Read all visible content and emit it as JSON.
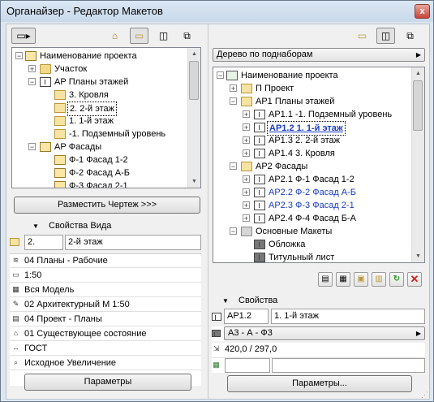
{
  "window": {
    "title": "Органайзер - Редактор Макетов",
    "close_label": "x"
  },
  "left": {
    "tree_root": "Наименование проекта",
    "items": [
      {
        "label": "Участок"
      },
      {
        "label": "АР Планы этажей"
      },
      {
        "label": "3. Кровля"
      },
      {
        "label": "2. 2-й этаж"
      },
      {
        "label": "1. 1-й этаж"
      },
      {
        "label": "-1. Подземный уровень"
      },
      {
        "label": "АР Фасады"
      },
      {
        "label": "Ф-1 Фасад 1-2"
      },
      {
        "label": "Ф-2 Фасад А-Б"
      },
      {
        "label": "Ф-3 Фасад 2-1"
      }
    ],
    "place_button": "Разместить Чертеж >>>",
    "section_title": "Свойства Вида",
    "id_value": "2.",
    "name_value": "2-й этаж",
    "props": [
      {
        "icon": "layers-icon",
        "glyph": "≋",
        "value": "04 Планы - Рабочие"
      },
      {
        "icon": "scale-icon",
        "glyph": "▭",
        "value": "1:50"
      },
      {
        "icon": "model-icon",
        "glyph": "▦",
        "value": "Вся Модель"
      },
      {
        "icon": "pen-set-icon",
        "glyph": "✎",
        "value": "02 Архитектурный М 1:50"
      },
      {
        "icon": "model-view-icon",
        "glyph": "▤",
        "value": "04 Проект - Планы"
      },
      {
        "icon": "renovation-icon",
        "glyph": "⌂",
        "value": "01 Существующее состояние"
      },
      {
        "icon": "dimension-icon",
        "glyph": "↔",
        "value": "ГОСТ"
      },
      {
        "icon": "zoom-icon",
        "glyph": "⌕",
        "value": "Исходное Увеличение"
      }
    ],
    "params_button": "Параметры"
  },
  "right": {
    "mode_dropdown": "Дерево по поднаборам",
    "tree_root": "Наименование проекта",
    "items": [
      {
        "label": "П Проект"
      },
      {
        "label": "АР1 Планы этажей"
      },
      {
        "label": "АР1.1 -1. Подземный уровень"
      },
      {
        "label": "АР1.2 1. 1-й этаж"
      },
      {
        "label": "АР1.3 2. 2-й этаж"
      },
      {
        "label": "АР1.4 3. Кровля"
      },
      {
        "label": "АР2 Фасады"
      },
      {
        "label": "АР2.1 Ф-1 Фасад 1-2"
      },
      {
        "label": "АР2.2 Ф-2 Фасад А-Б"
      },
      {
        "label": "АР2.3 Ф-3 Фасад 2-1"
      },
      {
        "label": "АР2.4 Ф-4 Фасад Б-А"
      },
      {
        "label": "Основные Макеты"
      },
      {
        "label": "Обложка"
      },
      {
        "label": "Титульный лист"
      }
    ],
    "section_title": "Свойства",
    "id_value": "АР1.2",
    "name_value": "1. 1-й этаж",
    "format_value": "А3 - А - Ф3",
    "size_value": "420,0 / 297,0",
    "params_button": "Параметры..."
  },
  "colors": {
    "link_blue": "#1a3dc8",
    "delete_red": "#d9201a",
    "refresh_green": "#2e9a2e"
  }
}
